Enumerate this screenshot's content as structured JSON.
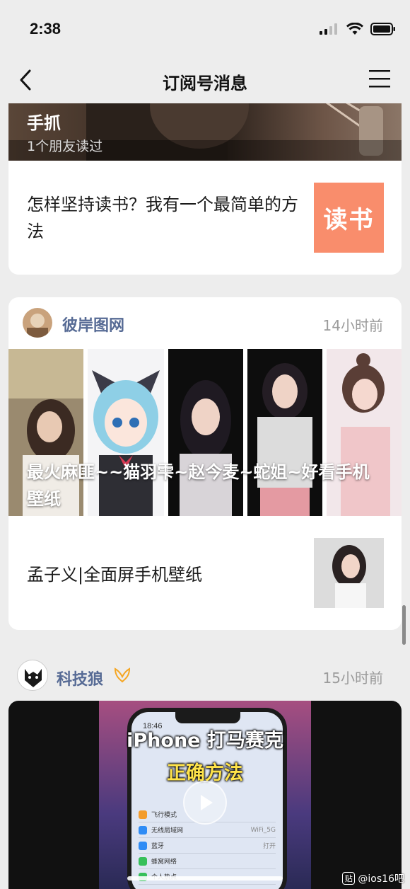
{
  "status_bar": {
    "time": "2:38"
  },
  "nav": {
    "title": "订阅号消息"
  },
  "card1": {
    "hero_title": "手抓",
    "hero_sub": "1个朋友读过",
    "article_title": "怎样坚持读书？我有一个最简单的方法",
    "thumb_text": "读书"
  },
  "card2": {
    "account": "彼岸图网",
    "time": "14小时前",
    "caption": "最火麻匪~~猫羽雫~赵今麦~蛇姐~好看手机壁纸",
    "article_title": "孟子义|全面屏手机壁纸"
  },
  "card3": {
    "account": "科技狼",
    "time": "15小时前",
    "video_title_line1": "iPhone 打马赛克",
    "video_title_line2": "正确方法",
    "phone_time": "18:46",
    "settings": [
      {
        "label": "飞行模式",
        "value": "",
        "color": "#f39c2b"
      },
      {
        "label": "无线局域网",
        "value": "WiFi_5G",
        "color": "#2f8cf5"
      },
      {
        "label": "蓝牙",
        "value": "打开",
        "color": "#2f8cf5"
      },
      {
        "label": "蜂窝网络",
        "value": "",
        "color": "#37c05a"
      },
      {
        "label": "个人热点",
        "value": "",
        "color": "#37c05a"
      }
    ]
  },
  "watermark": {
    "logo": "贴",
    "text": "@ios16吧"
  }
}
